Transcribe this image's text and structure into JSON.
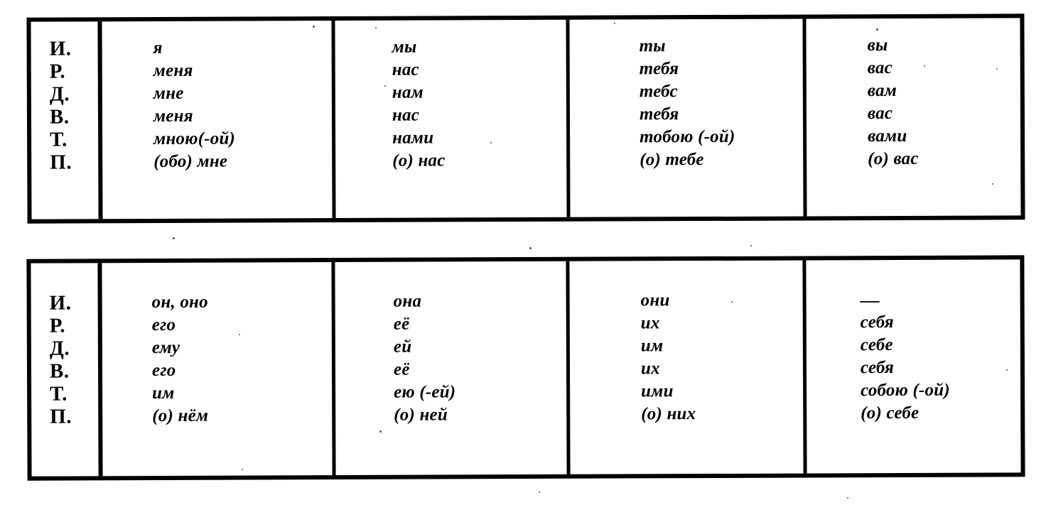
{
  "document": {
    "kind": "russian-pronoun-declension-chart",
    "tables": [
      {
        "id": "personal-pronouns-1st-2nd",
        "case_labels": [
          "И.",
          "Р.",
          "Д.",
          "В.",
          "Т.",
          "П."
        ],
        "columns": [
          {
            "id": "ya",
            "forms": [
              "я",
              "меня",
              "мне",
              "меня",
              "мною(-ой)",
              "(обо) мне"
            ]
          },
          {
            "id": "my",
            "forms": [
              "мы",
              "нас",
              "нам",
              "нас",
              "нами",
              "(о) нас"
            ]
          },
          {
            "id": "ty",
            "forms": [
              "ты",
              "тебя",
              "тебс",
              "тебя",
              "тобою (-ой)",
              "(о) тебе"
            ]
          },
          {
            "id": "vy",
            "forms": [
              "вы",
              "вас",
              "вам",
              "вас",
              "вами",
              "(о) вас"
            ]
          }
        ]
      },
      {
        "id": "personal-pronouns-3rd-and-reflexive",
        "case_labels": [
          "И.",
          "Р.",
          "Д.",
          "В.",
          "Т.",
          "П."
        ],
        "columns": [
          {
            "id": "on-ono",
            "forms": [
              "он, оно",
              "его",
              "ему",
              "его",
              "им",
              "(о) нём"
            ]
          },
          {
            "id": "ona",
            "forms": [
              "она",
              "её",
              "ей",
              "её",
              "ею (-ей)",
              "(о) ней"
            ]
          },
          {
            "id": "oni",
            "forms": [
              "они",
              "их",
              "им",
              "их",
              "ими",
              "(о) них"
            ]
          },
          {
            "id": "sebya",
            "forms": [
              "—",
              "себя",
              "себе",
              "себя",
              "собою (-ой)",
              "(о) себе"
            ]
          }
        ]
      }
    ]
  },
  "colors": {
    "ink": "#000000",
    "paper": "#ffffff"
  }
}
